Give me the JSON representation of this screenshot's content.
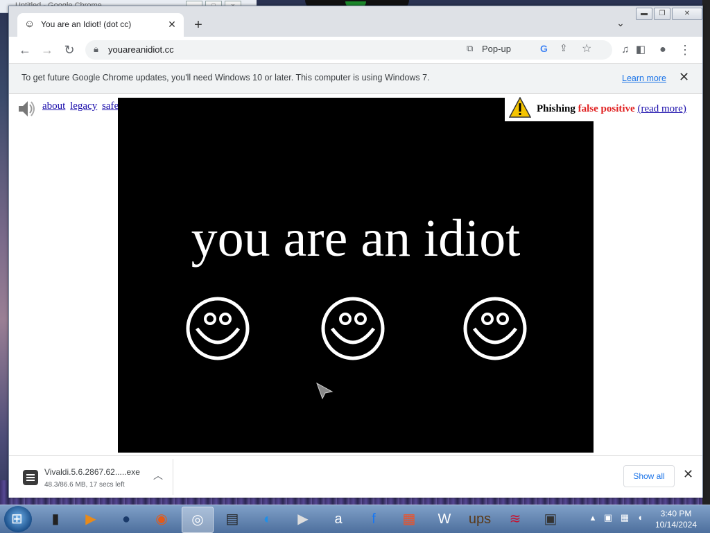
{
  "desktop": {
    "background_window_title": "Untitled - Google Chrome"
  },
  "browser": {
    "tab": {
      "favicon": "smiley-icon",
      "title": "You are an Idiot! (dot cc)"
    },
    "new_tab_symbol": "+",
    "toolbar": {
      "back_icon": "←",
      "forward_icon": "→",
      "reload_icon": "↻",
      "url": "youareanidiot.cc",
      "popup_label": "Pop-up"
    },
    "infobar": {
      "message": "To get future Google Chrome updates, you'll need Windows 10 or later. This computer is using Windows 7.",
      "learn_more": "Learn more"
    }
  },
  "page": {
    "links": [
      "about",
      "legacy",
      "safe"
    ],
    "video_caption": "you are an idiot",
    "phishing": {
      "label": "Phishing",
      "status": "false positive",
      "read_more": "(read more)"
    }
  },
  "download": {
    "filename": "Vivaldi.5.6.2867.62.....exe",
    "status": "48.3/86.6 MB, 17 secs left",
    "show_all": "Show all"
  },
  "taskbar": {
    "time": "3:40 PM",
    "date": "10/14/2024",
    "apps": [
      {
        "name": "black-tablet-icon",
        "glyph": "▮"
      },
      {
        "name": "media-player-icon",
        "glyph": "▶"
      },
      {
        "name": "globe-icon",
        "glyph": "●"
      },
      {
        "name": "firefox-icon",
        "glyph": "◉"
      },
      {
        "name": "chrome-icon",
        "glyph": "◎"
      },
      {
        "name": "terminal-icon",
        "glyph": "▤"
      },
      {
        "name": "edge-icon",
        "glyph": "◐"
      },
      {
        "name": "youtube-icon",
        "glyph": "▶"
      },
      {
        "name": "amazon-icon",
        "glyph": "a"
      },
      {
        "name": "facebook-icon",
        "glyph": "f"
      },
      {
        "name": "microsoft-icon",
        "glyph": "▦"
      },
      {
        "name": "wikipedia-icon",
        "glyph": "W"
      },
      {
        "name": "ups-icon",
        "glyph": "ups"
      },
      {
        "name": "bank-of-america-icon",
        "glyph": "≋"
      },
      {
        "name": "store-icon",
        "glyph": "▣"
      }
    ]
  },
  "colors": {
    "phishing_status": "#e02020",
    "link": "#1a0dab",
    "chrome_blue": "#1a73e8"
  }
}
